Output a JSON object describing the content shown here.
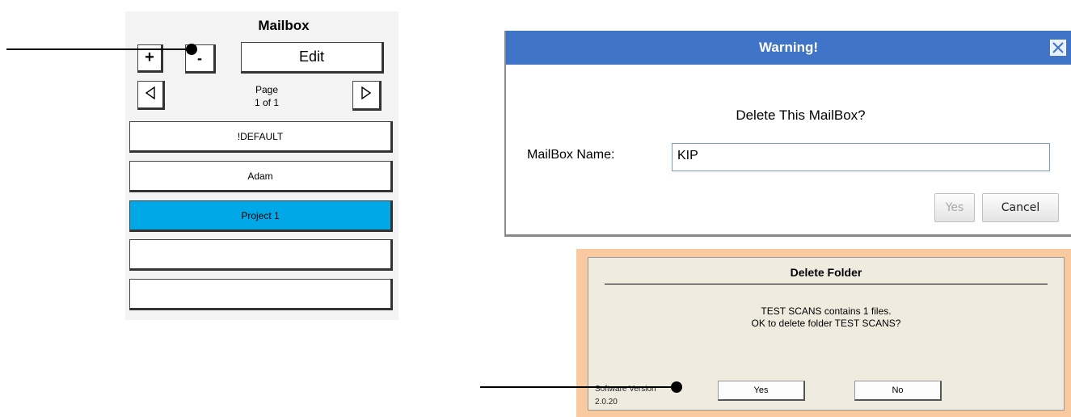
{
  "mailbox": {
    "title": "Mailbox",
    "add_label": "+",
    "remove_label": "-",
    "edit_label": "Edit",
    "page_label": "Page",
    "page_value": "1 of 1",
    "items": [
      {
        "label": "!DEFAULT",
        "selected": false
      },
      {
        "label": "Adam",
        "selected": false
      },
      {
        "label": "Project 1",
        "selected": true
      },
      {
        "label": "",
        "selected": false
      },
      {
        "label": "",
        "selected": false
      }
    ],
    "selected_color": "#00a8e8"
  },
  "warning_dialog": {
    "title": "Warning!",
    "question": "Delete This MailBox?",
    "name_label": "MailBox Name:",
    "name_value": "KIP",
    "yes_label": "Yes",
    "cancel_label": "Cancel",
    "titlebar_color": "#3f74c8"
  },
  "delete_dialog": {
    "title": "Delete Folder",
    "message_line1": "TEST SCANS contains 1 files.",
    "message_line2": "OK to delete folder TEST SCANS?",
    "yes_label": "Yes",
    "no_label": "No",
    "version_label": "Software Version",
    "version_value": "2.0.20",
    "border_color": "#f9c9a0"
  }
}
